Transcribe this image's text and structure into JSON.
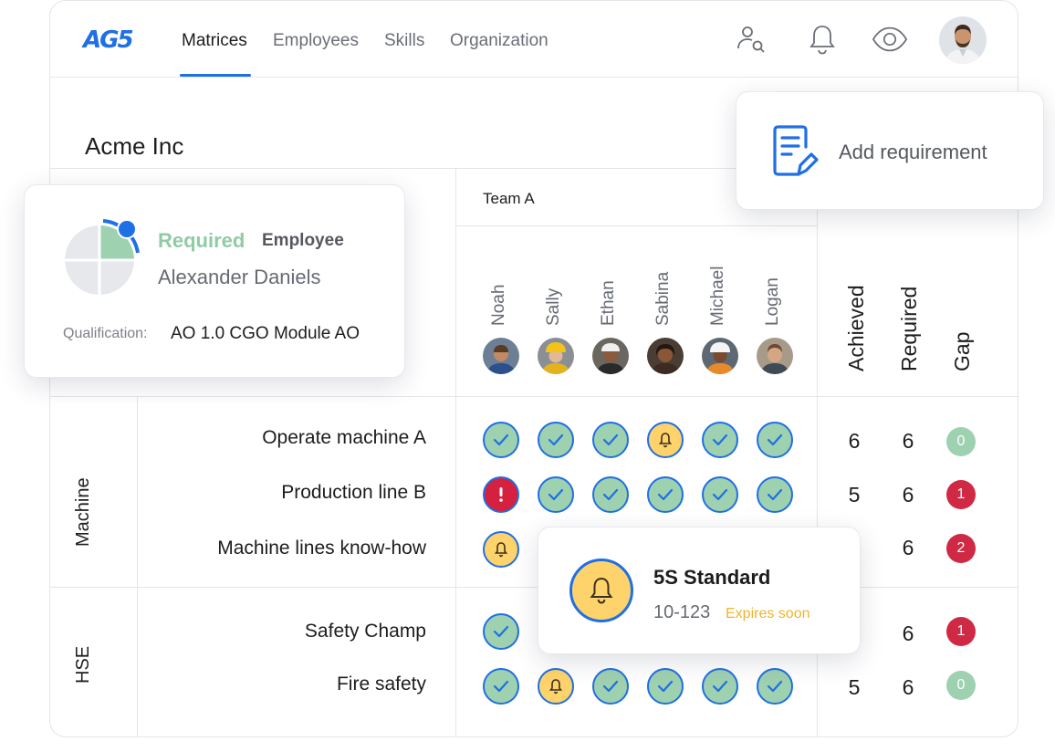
{
  "logo": "AG5",
  "nav": {
    "tabs": [
      {
        "label": "Matrices",
        "active": true
      },
      {
        "label": "Employees",
        "active": false
      },
      {
        "label": "Skills",
        "active": false
      },
      {
        "label": "Organization",
        "active": false
      }
    ],
    "icons": [
      "user-search-icon",
      "bell-icon",
      "eye-icon"
    ]
  },
  "company": "Acme Inc",
  "team": "Team A",
  "employees": [
    "Noah",
    "Sally",
    "Ethan",
    "Sabina",
    "Michael",
    "Logan"
  ],
  "summary_headers": [
    "Achieved",
    "Required",
    "Gap"
  ],
  "groups": [
    {
      "label": "Machine",
      "skills": [
        {
          "name": "Operate machine A",
          "cells": [
            "ok",
            "ok",
            "ok",
            "warn",
            "ok",
            "ok"
          ],
          "achieved": "6",
          "required": "6",
          "gap": "0"
        },
        {
          "name": "Production line B",
          "cells": [
            "err",
            "ok",
            "ok",
            "ok",
            "ok",
            "ok"
          ],
          "achieved": "5",
          "required": "6",
          "gap": "1"
        },
        {
          "name": "Machine lines know-how",
          "cells": [
            "warn",
            "",
            "",
            "",
            "",
            ""
          ],
          "achieved": "",
          "required": "6",
          "gap": "2"
        }
      ]
    },
    {
      "label": "HSE",
      "skills": [
        {
          "name": "Safety Champ",
          "cells": [
            "ok",
            "",
            "",
            "",
            "",
            ""
          ],
          "achieved": "",
          "required": "6",
          "gap": "1"
        },
        {
          "name": "Fire safety",
          "cells": [
            "ok",
            "warn",
            "ok",
            "ok",
            "ok",
            "ok"
          ],
          "achieved": "5",
          "required": "6",
          "gap": "0"
        }
      ]
    }
  ],
  "requirement_card": {
    "status": "Required",
    "role": "Employee",
    "name": "Alexander Daniels",
    "qualification_label": "Qualification:",
    "qualification_value": "AO 1.0 CGO Module AO"
  },
  "add_requirement": {
    "label": "Add requirement"
  },
  "standard_popup": {
    "title": "5S Standard",
    "code": "10-123",
    "status": "Expires soon"
  },
  "colors": {
    "accent": "#1f6fe5",
    "achieved": "#9ed1b0",
    "warning": "#ffd36b",
    "error": "#d6203f",
    "expires": "#f0b429"
  }
}
